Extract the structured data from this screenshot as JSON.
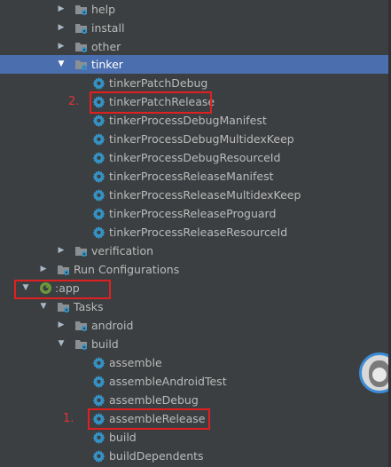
{
  "tree": {
    "rows": [
      {
        "label": "help",
        "kind": "folder",
        "arrow": "right"
      },
      {
        "label": "install",
        "kind": "folder",
        "arrow": "right"
      },
      {
        "label": "other",
        "kind": "folder",
        "arrow": "right"
      },
      {
        "label": "tinker",
        "kind": "folder",
        "arrow": "down"
      },
      {
        "label": "tinkerPatchDebug",
        "kind": "gear",
        "arrow": ""
      },
      {
        "label": "tinkerPatchRelease",
        "kind": "gear",
        "arrow": ""
      },
      {
        "label": "tinkerProcessDebugManifest",
        "kind": "gear",
        "arrow": ""
      },
      {
        "label": "tinkerProcessDebugMultidexKeep",
        "kind": "gear",
        "arrow": ""
      },
      {
        "label": "tinkerProcessDebugResourceId",
        "kind": "gear",
        "arrow": ""
      },
      {
        "label": "tinkerProcessReleaseManifest",
        "kind": "gear",
        "arrow": ""
      },
      {
        "label": "tinkerProcessReleaseMultidexKeep",
        "kind": "gear",
        "arrow": ""
      },
      {
        "label": "tinkerProcessReleaseProguard",
        "kind": "gear",
        "arrow": ""
      },
      {
        "label": "tinkerProcessReleaseResourceId",
        "kind": "gear",
        "arrow": ""
      },
      {
        "label": "verification",
        "kind": "folder",
        "arrow": "right"
      },
      {
        "label": "Run Configurations",
        "kind": "folder",
        "arrow": "right"
      },
      {
        "label": ":app",
        "kind": "module",
        "arrow": "down"
      },
      {
        "label": "Tasks",
        "kind": "folder",
        "arrow": "down"
      },
      {
        "label": "android",
        "kind": "folder",
        "arrow": "right"
      },
      {
        "label": "build",
        "kind": "folder",
        "arrow": "down"
      },
      {
        "label": "assemble",
        "kind": "gear",
        "arrow": ""
      },
      {
        "label": "assembleAndroidTest",
        "kind": "gear",
        "arrow": ""
      },
      {
        "label": "assembleDebug",
        "kind": "gear",
        "arrow": ""
      },
      {
        "label": "assembleRelease",
        "kind": "gear",
        "arrow": ""
      },
      {
        "label": "build",
        "kind": "gear",
        "arrow": ""
      },
      {
        "label": "buildDependents",
        "kind": "gear",
        "arrow": ""
      }
    ]
  },
  "annotations": {
    "step1": "1.",
    "step2": "2."
  },
  "colors": {
    "background": "#3c3f41",
    "selection": "#4b6eaf",
    "annotation_red": "#e02020",
    "gear_blue": "#3592c4",
    "module_green": "#6a9a3a"
  }
}
